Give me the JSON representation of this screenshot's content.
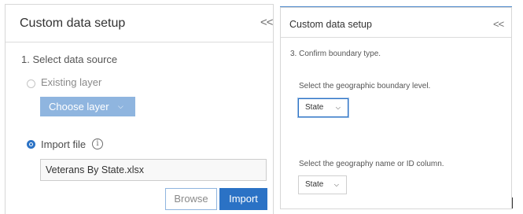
{
  "left_panel": {
    "title": "Custom data setup",
    "collapse_glyph": "<<",
    "step": "1.  Select data source",
    "existing_layer_label": "Existing layer",
    "choose_layer_label": "Choose layer",
    "import_file_label": "Import file",
    "info_glyph": "i",
    "file_value": "Veterans By State.xlsx",
    "browse_label": "Browse",
    "import_label": "Import",
    "selected_source": "Import file"
  },
  "right_panel": {
    "title": "Custom data setup",
    "collapse_glyph": "<<",
    "step": "3.  Confirm boundary type.",
    "boundary_prompt": "Select the geographic boundary level.",
    "boundary_value": "State",
    "column_prompt": "Select the geography name or ID column.",
    "column_value": "State"
  },
  "icons": {
    "collapse": "double-chevron-left-icon",
    "dropdown": "chevron-down-icon",
    "info": "info-circle-icon"
  },
  "colors": {
    "accent": "#2b72c5",
    "accent_disabled": "#8fb5df",
    "border": "#d7d7d7"
  }
}
